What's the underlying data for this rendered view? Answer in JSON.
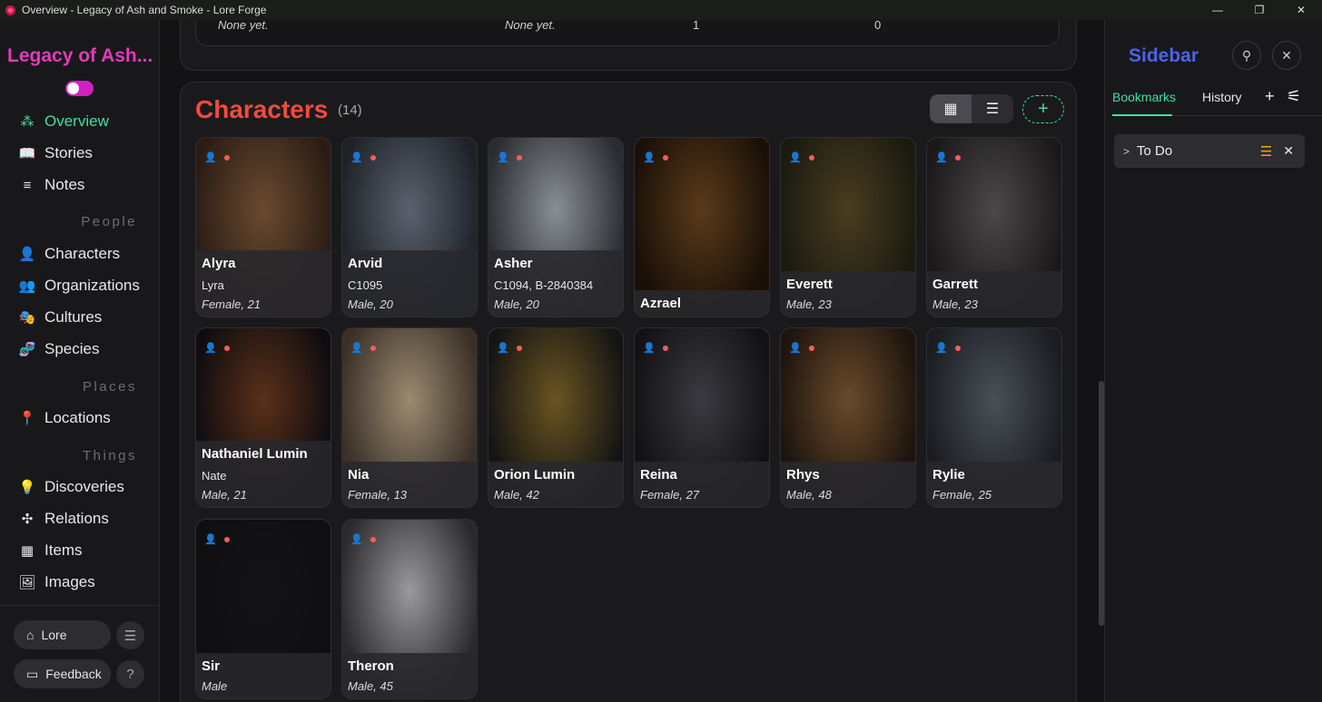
{
  "window": {
    "title": "Overview - Legacy of Ash and Smoke - Lore Forge",
    "controls": [
      "—",
      "❐",
      "✕"
    ]
  },
  "nav": {
    "app_title": "Legacy of Ash...",
    "items": [
      {
        "label": "Overview",
        "icon": "overview-icon",
        "glyph": "⁂"
      },
      {
        "label": "Stories",
        "icon": "book-icon",
        "glyph": "📖"
      },
      {
        "label": "Notes",
        "icon": "notes-icon",
        "glyph": "≡"
      },
      {
        "label": "Characters",
        "icon": "person-icon",
        "glyph": "👤"
      },
      {
        "label": "Organizations",
        "icon": "group-icon",
        "glyph": "👥"
      },
      {
        "label": "Cultures",
        "icon": "masks-icon",
        "glyph": "🎭"
      },
      {
        "label": "Species",
        "icon": "dna-icon",
        "glyph": "🧬"
      },
      {
        "label": "Locations",
        "icon": "pin-icon",
        "glyph": "📍"
      },
      {
        "label": "Discoveries",
        "icon": "bulb-icon",
        "glyph": "💡"
      },
      {
        "label": "Relations",
        "icon": "network-icon",
        "glyph": "✣"
      },
      {
        "label": "Items",
        "icon": "items-icon",
        "glyph": "▦"
      },
      {
        "label": "Images",
        "icon": "image-icon",
        "glyph": "🖼"
      }
    ],
    "sections": [
      "People",
      "Places",
      "Things"
    ],
    "lore_label": "Lore",
    "feedback_label": "Feedback"
  },
  "top_table": {
    "cells": [
      "None yet.",
      "None yet.",
      "1",
      "0"
    ]
  },
  "characters": {
    "title": "Characters",
    "count": "(14)",
    "cards": [
      {
        "name": "Alyra",
        "alias": "Lyra",
        "info": "Female, 21"
      },
      {
        "name": "Arvid",
        "alias": "C1095",
        "info": "Male, 20"
      },
      {
        "name": "Asher",
        "alias": "C1094, B-2840384",
        "info": "Male, 20"
      },
      {
        "name": "Azrael",
        "alias": "",
        "info": ""
      },
      {
        "name": "Everett",
        "alias": "",
        "info": "Male, 23"
      },
      {
        "name": "Garrett",
        "alias": "",
        "info": "Male, 23"
      },
      {
        "name": "Nathaniel Lumin",
        "alias": "Nate",
        "info": "Male, 21"
      },
      {
        "name": "Nia",
        "alias": "",
        "info": "Female, 13"
      },
      {
        "name": "Orion Lumin",
        "alias": "",
        "info": "Male, 42"
      },
      {
        "name": "Reina",
        "alias": "",
        "info": "Female, 27"
      },
      {
        "name": "Rhys",
        "alias": "",
        "info": "Male, 48"
      },
      {
        "name": "Rylie",
        "alias": "",
        "info": "Female, 25"
      },
      {
        "name": "Sir",
        "alias": "",
        "info": "Male"
      },
      {
        "name": "Theron",
        "alias": "",
        "info": "Male, 45"
      }
    ]
  },
  "sidebar": {
    "title": "Sidebar",
    "tabs": [
      "Bookmarks",
      "History"
    ],
    "bookmark": "To Do"
  },
  "colors": {
    "accent_green": "#3fe0a0",
    "app_title": "#e23bb8",
    "characters_title": "#ef4b3c",
    "sidebar_title": "#4d63e8"
  }
}
